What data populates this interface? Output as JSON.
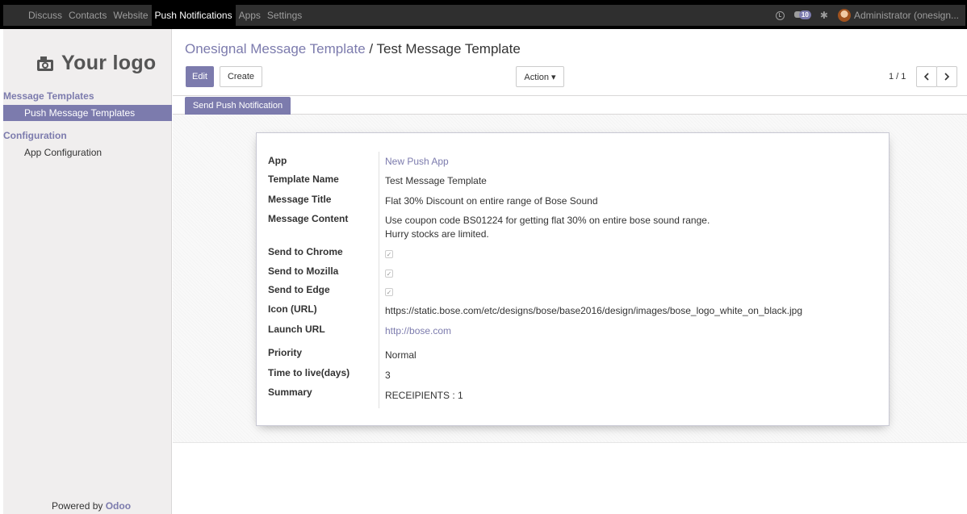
{
  "topbar": {
    "menu": [
      "Discuss",
      "Contacts",
      "Website",
      "Push Notifications",
      "Apps",
      "Settings"
    ],
    "active": "Push Notifications",
    "chat_badge": "10",
    "user": "Administrator (onesign..."
  },
  "sidebar": {
    "logo": "Your logo",
    "section_templates": "Message Templates",
    "item_push_templates": "Push Message Templates",
    "section_config": "Configuration",
    "item_app_config": "App Configuration",
    "powered_prefix": "Powered by ",
    "powered_brand": "Odoo"
  },
  "header": {
    "breadcrumb_parent": "Onesignal Message Template",
    "breadcrumb_sep": " / ",
    "breadcrumb_current": "Test Message Template",
    "edit_label": "Edit",
    "create_label": "Create",
    "action_label": "Action ▾",
    "pager": "1 / 1",
    "send_push_label": "Send Push Notification"
  },
  "form": {
    "app_label": "App",
    "app_value": "New Push App",
    "template_name_label": "Template Name",
    "template_name_value": "Test Message Template",
    "message_title_label": "Message Title",
    "message_title_value": "Flat 30% Discount on entire range of Bose Sound",
    "message_content_label": "Message Content",
    "message_content_line1": "Use coupon code BS01224 for getting flat 30% on entire bose sound range.",
    "message_content_line2": "Hurry stocks are limited.",
    "send_chrome_label": "Send to Chrome",
    "send_chrome_checked": true,
    "send_mozilla_label": "Send to Mozilla",
    "send_mozilla_checked": true,
    "send_edge_label": "Send to Edge",
    "send_edge_checked": true,
    "icon_url_label": "Icon (URL)",
    "icon_url_value": "https://static.bose.com/etc/designs/bose/base2016/design/images/bose_logo_white_on_black.jpg",
    "launch_url_label": "Launch URL",
    "launch_url_value": "http://bose.com",
    "priority_label": "Priority",
    "priority_value": "Normal",
    "ttl_label": "Time to live(days)",
    "ttl_value": "3",
    "summary_label": "Summary",
    "summary_value": "RECEIPIENTS : 1"
  },
  "colors": {
    "accent": "#7c7bad",
    "topbar": "#2f2f2f",
    "sidebar": "#f0eeee"
  },
  "icons": [
    "clock-icon",
    "chat-icon",
    "bug-icon",
    "camera-icon",
    "chevron-left-icon",
    "chevron-right-icon"
  ]
}
